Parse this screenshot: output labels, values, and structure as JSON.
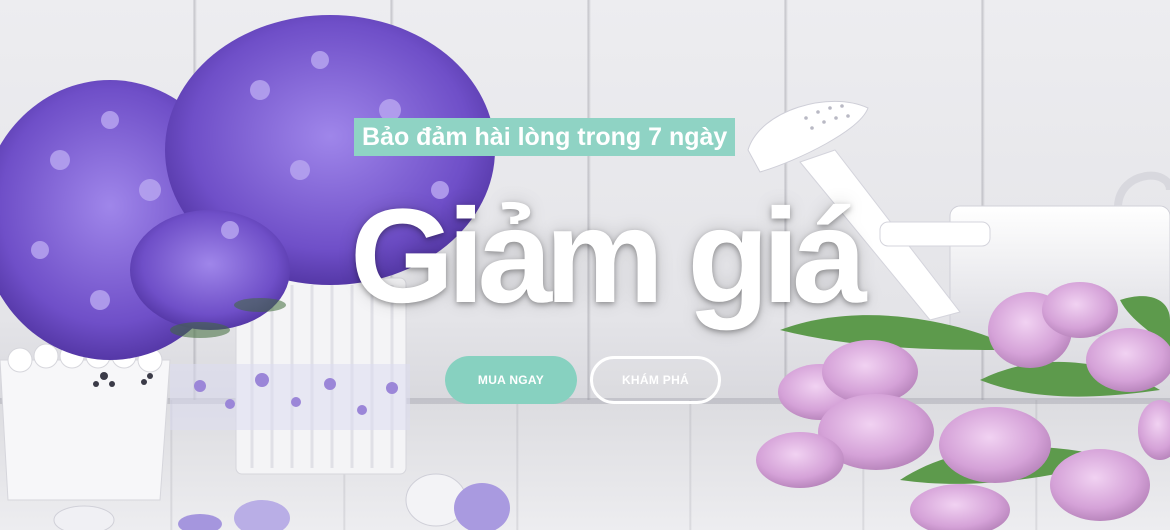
{
  "hero": {
    "badge_text": "Bảo đảm hài lòng trong 7 ngày",
    "headline": "Giảm giá",
    "buy_button": "MUA NGAY",
    "explore_button": "KHÁM PHÁ"
  },
  "colors": {
    "accent": "#87d1c0",
    "badge": "#8fd3c4",
    "text": "#ffffff",
    "flowers_purple": "#7b5bd1",
    "tulips_pink": "#d9a8dc"
  },
  "icons": {
    "background": "flower-garden-photo",
    "left": "purple-flower-pots",
    "right": "watering-can-and-tulips"
  }
}
